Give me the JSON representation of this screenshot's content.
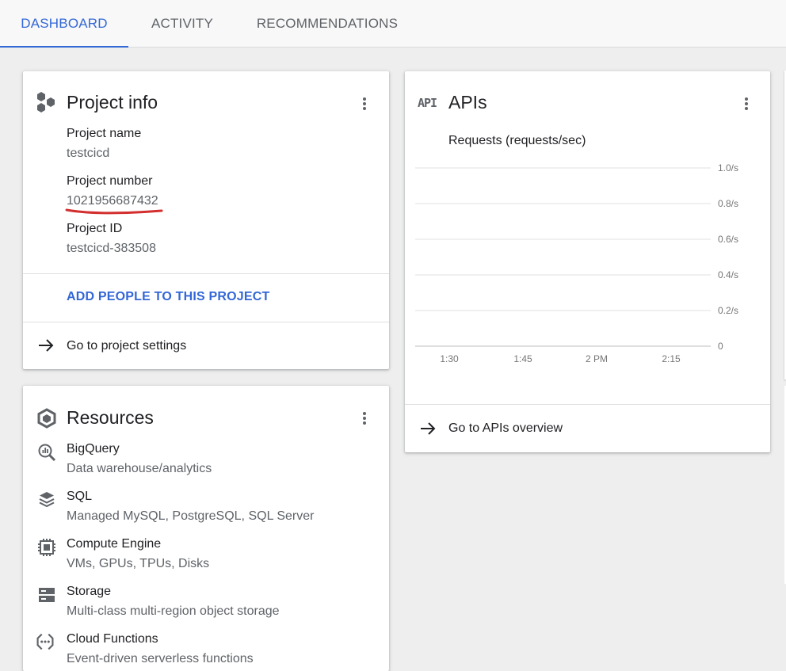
{
  "tabs": {
    "dashboard": "DASHBOARD",
    "activity": "ACTIVITY",
    "recommendations": "RECOMMENDATIONS"
  },
  "project_info": {
    "title": "Project info",
    "name_label": "Project name",
    "name_value": "testcicd",
    "number_label": "Project number",
    "number_value": "1021956687432",
    "id_label": "Project ID",
    "id_value": "testcicd-383508",
    "add_people": "ADD PEOPLE TO THIS PROJECT",
    "settings_link": "Go to project settings"
  },
  "apis": {
    "title": "APIs",
    "icon_text": "API",
    "overview_link": "Go to APIs overview"
  },
  "chart_data": {
    "type": "line",
    "title": "Requests (requests/sec)",
    "x_ticks": [
      "1:30",
      "1:45",
      "2 PM",
      "2:15"
    ],
    "y_ticks": [
      "1.0/s",
      "0.8/s",
      "0.6/s",
      "0.4/s",
      "0.2/s",
      "0"
    ],
    "ylim": [
      0,
      1.0
    ],
    "series": [],
    "grid": true
  },
  "resources": {
    "title": "Resources",
    "items": [
      {
        "name": "BigQuery",
        "desc": "Data warehouse/analytics",
        "icon": "bigquery-icon"
      },
      {
        "name": "SQL",
        "desc": "Managed MySQL, PostgreSQL, SQL Server",
        "icon": "sql-icon"
      },
      {
        "name": "Compute Engine",
        "desc": "VMs, GPUs, TPUs, Disks",
        "icon": "compute-engine-icon"
      },
      {
        "name": "Storage",
        "desc": "Multi-class multi-region object storage",
        "icon": "storage-icon"
      },
      {
        "name": "Cloud Functions",
        "desc": "Event-driven serverless functions",
        "icon": "cloud-functions-icon"
      }
    ]
  },
  "colors": {
    "accent": "#3367d6",
    "annotation": "#d32f2f"
  }
}
